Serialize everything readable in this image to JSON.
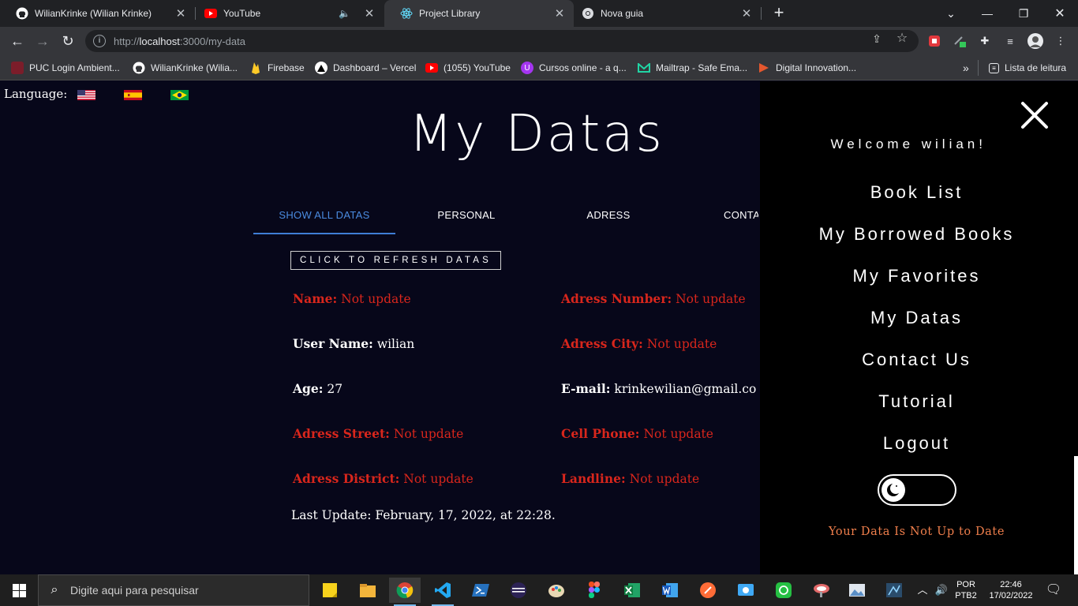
{
  "browser": {
    "tabs": [
      {
        "title": "WilianKrinke (Wilian Krinke)",
        "icon": "github-icon"
      },
      {
        "title": "YouTube",
        "icon": "youtube-icon"
      },
      {
        "title": "Project Library",
        "icon": "react-icon"
      },
      {
        "title": "Nova guia",
        "icon": "chrome-icon"
      }
    ],
    "url_host": "localhost",
    "url_rest": ":3000/my-data",
    "url_scheme": "http://",
    "bookmarks": [
      "PUC Login Ambient...",
      "WilianKrinke (Wilia...",
      "Firebase",
      "Dashboard – Vercel",
      "(1055) YouTube",
      "Cursos online - a q...",
      "Mailtrap - Safe Ema...",
      "Digital Innovation..."
    ],
    "reading_list": "Lista de leitura"
  },
  "page": {
    "language_label": "Language:",
    "flags": [
      "us-flag-icon",
      "es-flag-icon",
      "br-flag-icon"
    ],
    "title": "My Datas",
    "tabs": [
      "SHOW ALL DATAS",
      "PERSONAL",
      "ADRESS",
      "CONTA"
    ],
    "active_tab": 0,
    "refresh_button": "CLICK TO REFRESH DATAS",
    "fields_left": [
      {
        "label": "Name:",
        "value": "Not update",
        "missing": true
      },
      {
        "label": "User Name:",
        "value": "wilian",
        "missing": false
      },
      {
        "label": "Age:",
        "value": "27",
        "missing": false
      },
      {
        "label": "Adress Street:",
        "value": "Not update",
        "missing": true
      },
      {
        "label": "Adress District:",
        "value": "Not update",
        "missing": true
      }
    ],
    "fields_right": [
      {
        "label": "Adress Number:",
        "value": "Not update",
        "missing": true
      },
      {
        "label": "Adress City:",
        "value": "Not update",
        "missing": true
      },
      {
        "label": "E-mail:",
        "value": "krinkewilian@gmail.co",
        "missing": false
      },
      {
        "label": "Cell Phone:",
        "value": "Not update",
        "missing": true
      },
      {
        "label": "Landline:",
        "value": "Not update",
        "missing": true
      }
    ],
    "last_update": "Last Update: February, 17, 2022, at 22:28.",
    "colors": {
      "missing": "#d8261c",
      "active_tab": "#4a8be0",
      "warning": "#f07f4c"
    }
  },
  "side_menu": {
    "welcome": "Welcome wilian!",
    "items": [
      "Book List",
      "My Borrowed Books",
      "My Favorites",
      "My Datas",
      "Contact Us",
      "Tutorial",
      "Logout"
    ],
    "theme_toggle_icon": "moon-icon",
    "warning": "Your Data Is Not Up to Date"
  },
  "taskbar": {
    "search_placeholder": "Digite aqui para pesquisar",
    "lang_top": "POR",
    "lang_bottom": "PTB2",
    "time": "22:46",
    "date": "17/02/2022"
  }
}
